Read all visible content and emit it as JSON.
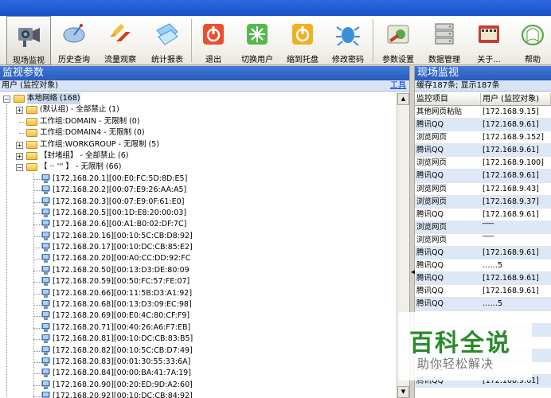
{
  "toolbar": {
    "buttons": [
      {
        "label": "现场监视",
        "icon": "camera-icon"
      },
      {
        "label": "历史查询",
        "icon": "satellite-dish-icon"
      },
      {
        "label": "流量观察",
        "icon": "traffic-arrows-icon"
      },
      {
        "label": "统计报表",
        "icon": "report-folder-icon"
      },
      {
        "label": "退出",
        "icon": "power-icon"
      },
      {
        "label": "切换用户",
        "icon": "sparkle-icon"
      },
      {
        "label": "缩到托盘",
        "icon": "power-yellow-icon"
      },
      {
        "label": "修改密码",
        "icon": "bug-icon"
      },
      {
        "label": "参数设置",
        "icon": "settings-tools-icon"
      },
      {
        "label": "数据管理",
        "icon": "server-icon"
      },
      {
        "label": "关于...",
        "icon": "film-icon"
      },
      {
        "label": "帮助",
        "icon": "help-book-icon"
      }
    ]
  },
  "left_panel": {
    "title": "监视参数",
    "subheader": "用户 (监控对象)",
    "tools_link": "工具",
    "tree": [
      {
        "expander": "-",
        "type": "folder",
        "label": "本地网络 (168)",
        "level": 0,
        "selected": true
      },
      {
        "expander": "+",
        "type": "folder",
        "label": "(默认组) - 全部禁止 (1)",
        "level": 1
      },
      {
        "expander": "",
        "type": "folder",
        "label": "工作组:DOMAIN - 无限制 (0)",
        "level": 1
      },
      {
        "expander": "",
        "type": "folder",
        "label": "工作组:DOMAIN4 - 无限制 (0)",
        "level": 1
      },
      {
        "expander": "+",
        "type": "folder",
        "label": "工作组:WORKGROUP - 无限制 (5)",
        "level": 1
      },
      {
        "expander": "+",
        "type": "folder",
        "label": "【封堵组】 - 全部禁止 (6)",
        "level": 1
      },
      {
        "expander": "-",
        "type": "folder",
        "label": "【 ·· ''' 】 - 无限制 (66)",
        "level": 1
      },
      {
        "type": "pc",
        "label": "[172.168.20.1][00:E0:FC:5D:8D:E5]",
        "level": 2
      },
      {
        "type": "pc",
        "label": "[172.168.20.2][00:07:E9:26:AA:A5]",
        "level": 2
      },
      {
        "type": "pc",
        "label": "[172.168.20.3][00:07:E9:0F:61:E0]",
        "level": 2
      },
      {
        "type": "pc",
        "label": "[172.168.20.5][00:1D:E8:20:00:03]",
        "level": 2
      },
      {
        "type": "pc",
        "label": "[172.168.20.6][00:A1:B0:02:DF:7C]",
        "level": 2
      },
      {
        "type": "pc",
        "label": "[172.168.20.16][00:10:5C:CB:D8:92]",
        "level": 2
      },
      {
        "type": "pc",
        "label": "[172.168.20.17][00:10:DC:CB:85:E2]",
        "level": 2
      },
      {
        "type": "pc",
        "label": "[172.168.20.20][00:A0:CC:DD:92:FC",
        "level": 2
      },
      {
        "type": "pc",
        "label": "[172.168.20.50][00:13:D3:DE:80:09",
        "level": 2
      },
      {
        "type": "pc",
        "label": "[172.168.20.59][00:50:FC:57:FE:07]",
        "level": 2
      },
      {
        "type": "pc",
        "label": "[172.168.20.66][00:11:5B:D3:A1:92]",
        "level": 2
      },
      {
        "type": "pc",
        "label": "[172.168.20.68][00:13:D3:09:EC:98]",
        "level": 2
      },
      {
        "type": "pc",
        "label": "[172.168.20.69][00:E0:4C:80:CF:F9]",
        "level": 2
      },
      {
        "type": "pc",
        "label": "[172.168.20.71][00:40:26:A6:F7:EB]",
        "level": 2
      },
      {
        "type": "pc",
        "label": "[172.168.20.81][00:10:DC:CB:83:B5]",
        "level": 2
      },
      {
        "type": "pc",
        "label": "[172.168.20.82][00:10:5C:CB:D7:49]",
        "level": 2
      },
      {
        "type": "pc",
        "label": "[172.168.20.83][00:01:30:55:33:6A]",
        "level": 2
      },
      {
        "type": "pc",
        "label": "[172.168.20.84][00:00:BA:41:7A:19]",
        "level": 2
      },
      {
        "type": "pc",
        "label": "[172.168.20.90][00:20:ED:9D:A2:60]",
        "level": 2
      },
      {
        "type": "pc",
        "label": "[172.168.20.92][00:10:DC:CB:84:92]",
        "level": 2
      }
    ]
  },
  "right_panel": {
    "title": "现场监视",
    "status": "缓存187条; 显示187条",
    "columns": [
      "监控项目",
      "用户 (监控对象)"
    ],
    "rows": [
      [
        "其他网页粘贴",
        "[172.168.9.15]"
      ],
      [
        "腾讯QQ",
        "[172.168.9.61]"
      ],
      [
        "浏览网页",
        "[172.168.9.152]"
      ],
      [
        "腾讯QQ",
        "[172.168.9.61]"
      ],
      [
        "浏览网页",
        "[172.168.9.100]"
      ],
      [
        "腾讯QQ",
        "[172.168.9.61]"
      ],
      [
        "浏览网页",
        "[172.168.9.43]"
      ],
      [
        "浏览网页",
        "[172.168.9.37]"
      ],
      [
        "腾讯QQ",
        "[172.168.9.61]"
      ],
      [
        "浏览网页",
        "‾‾‾"
      ],
      [
        "浏览网页",
        "‾‾‾"
      ],
      [
        "腾讯QQ",
        "[172.168.9.61]"
      ],
      [
        "腾讯QQ",
        "  ‥‥‥5"
      ],
      [
        "腾讯QQ",
        "[172.168.9.61]"
      ],
      [
        "腾讯QQ",
        "[172.168.9.61]"
      ],
      [
        "腾讯QQ",
        "  ‥‥‥5"
      ],
      [
        "",
        ""
      ],
      [
        "",
        ""
      ],
      [
        "",
        ""
      ],
      [
        "",
        "  ‥‥‥5"
      ],
      [
        "腾讯QQ",
        ""
      ],
      [
        "腾讯QQ",
        "[172.168.9.61]"
      ]
    ]
  },
  "watermark": {
    "line1": "百科全说",
    "line2": "助你轻松解决"
  },
  "colors": {
    "title_blue": "#2a5cbc",
    "row_alt": "#dde8f6",
    "watermark_green": "#2a8a2a"
  }
}
